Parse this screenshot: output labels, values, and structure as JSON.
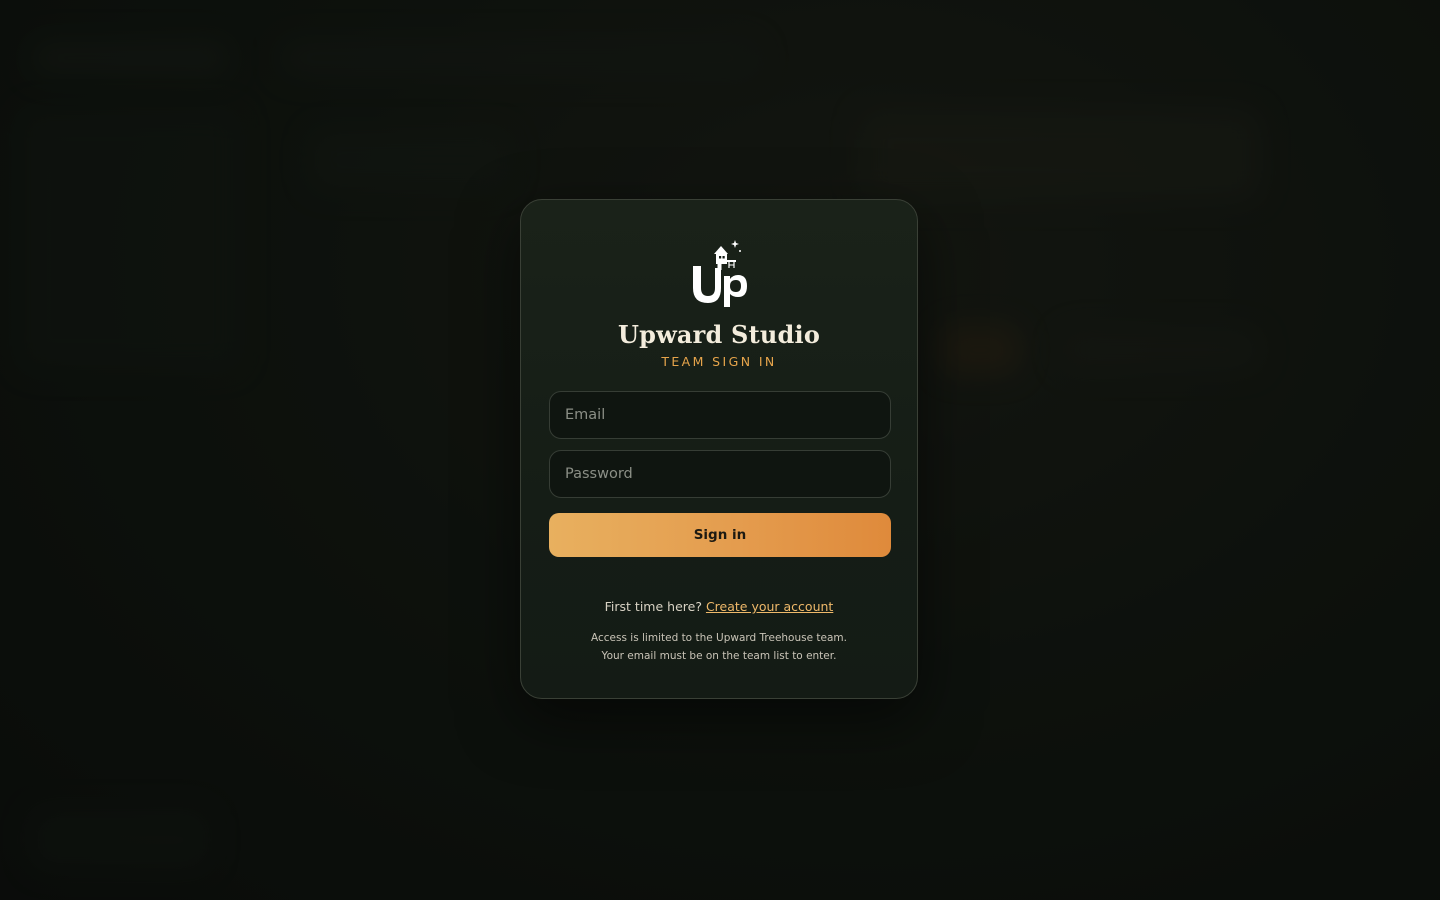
{
  "brand": {
    "logo_icon": "upward-treehouse-logo-icon",
    "name": "Upward Studio",
    "tagline": "TEAM SIGN IN"
  },
  "form": {
    "email_placeholder": "Email",
    "email_value": "",
    "password_placeholder": "Password",
    "password_value": "",
    "signin_label": "Sign in"
  },
  "signup": {
    "prompt": "First time here?",
    "link_label": "Create your account"
  },
  "notice": {
    "line1": "Access is limited to the Upward Treehouse team.",
    "line2": "Your email must be on the team list to enter."
  },
  "colors": {
    "accent": "#e6a44b",
    "button_start": "#e8b05f",
    "button_end": "#df8a3b",
    "card_background": "#172017",
    "page_background": "#0d110d"
  }
}
